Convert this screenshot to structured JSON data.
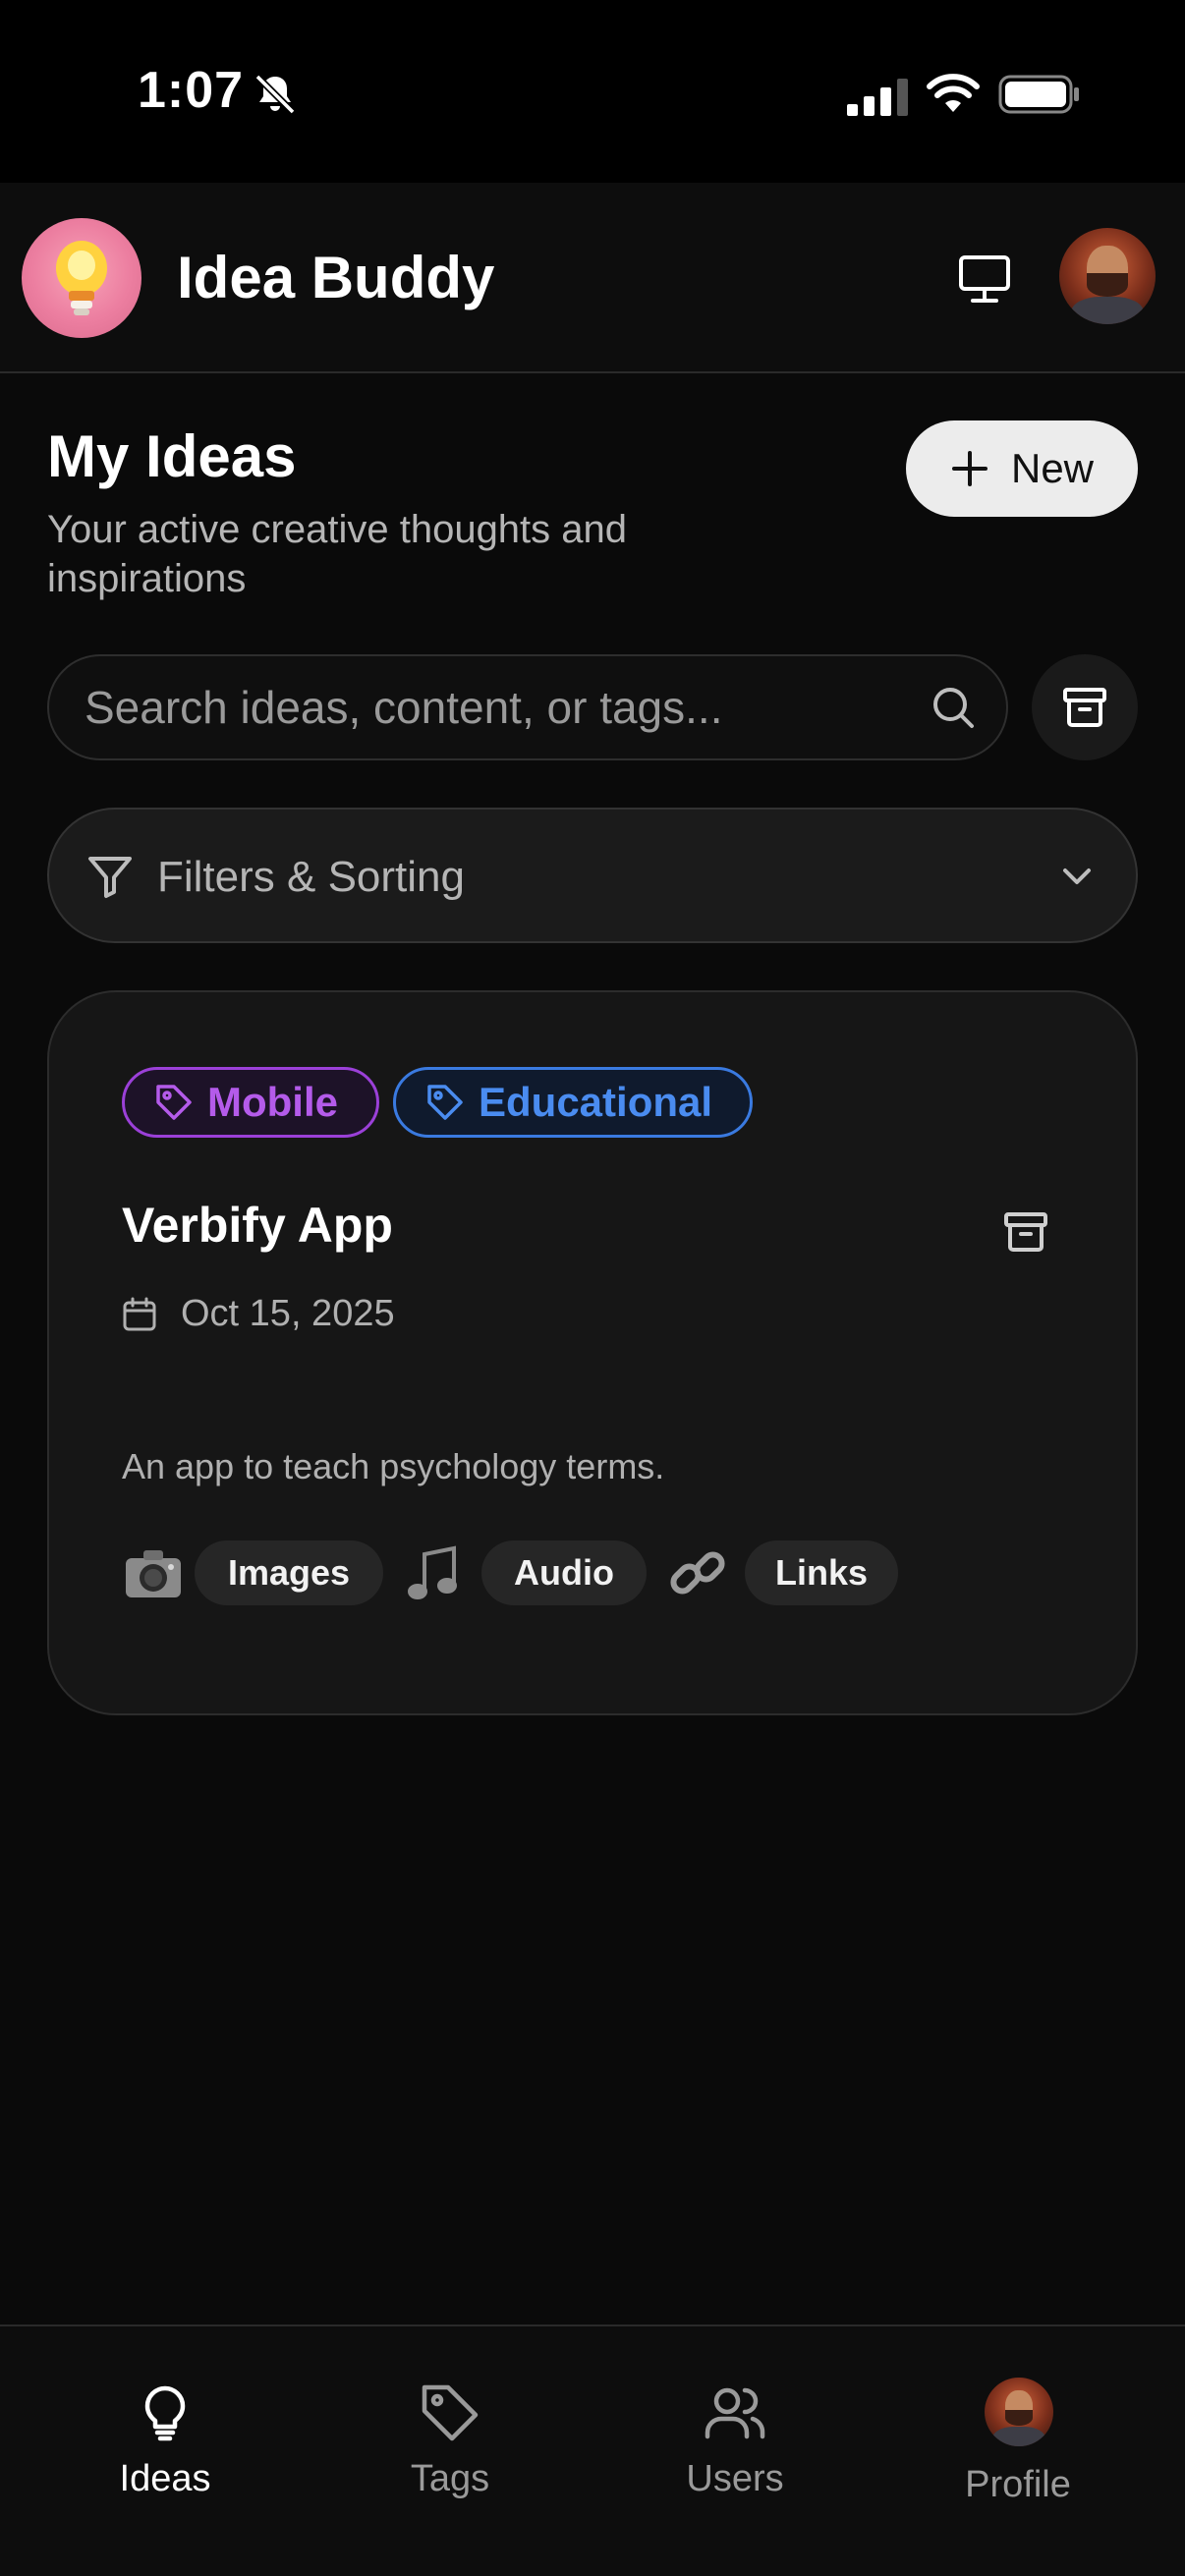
{
  "status_bar": {
    "time": "1:07"
  },
  "header": {
    "app_title": "Idea Buddy",
    "logo_icon": "lightbulb-icon",
    "display_toggle_icon": "monitor-icon"
  },
  "main": {
    "title": "My Ideas",
    "subtitle": "Your active creative thoughts and inspirations",
    "new_button_label": "New",
    "search": {
      "placeholder": "Search ideas, content, or tags...",
      "value": ""
    },
    "filters_label": "Filters & Sorting"
  },
  "ideas": [
    {
      "tags": [
        {
          "label": "Mobile",
          "color": "#b45bea"
        },
        {
          "label": "Educational",
          "color": "#4a8cf0"
        }
      ],
      "title": "Verbify App",
      "date": "Oct 15, 2025",
      "description": "An app to teach psychology terms.",
      "media": [
        {
          "emoji": "📷",
          "label": "Images"
        },
        {
          "emoji": "🎵",
          "label": "Audio"
        },
        {
          "emoji": "🔗",
          "label": "Links"
        }
      ]
    }
  ],
  "bottom_nav": {
    "items": [
      {
        "label": "Ideas",
        "icon": "lightbulb-icon",
        "active": true
      },
      {
        "label": "Tags",
        "icon": "tag-icon",
        "active": false
      },
      {
        "label": "Users",
        "icon": "users-icon",
        "active": false
      },
      {
        "label": "Profile",
        "icon": "avatar",
        "active": false
      }
    ]
  },
  "colors": {
    "background": "#0a0a0a",
    "card": "#161616",
    "tag_purple": "#9b40d8",
    "tag_blue": "#3a7ae0"
  }
}
